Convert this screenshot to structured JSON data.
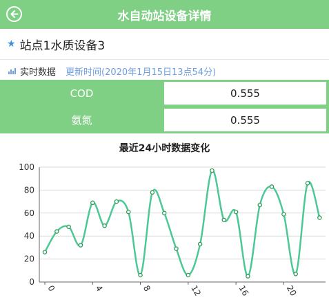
{
  "header": {
    "title": "水自动站设备详情",
    "back_icon": "back-arrow-icon"
  },
  "device": {
    "star_icon": "★",
    "name": "站点1水质设备3"
  },
  "realtime": {
    "label": "实时数据",
    "update_text": "更新时间(2020年1月15日13点54分)"
  },
  "readings": [
    {
      "label": "COD",
      "value": "0.555"
    },
    {
      "label": "氨氮",
      "value": "0.555"
    }
  ],
  "chart_data": {
    "type": "line",
    "title": "最近24小时数据变化",
    "x": [
      0,
      1,
      2,
      3,
      4,
      5,
      6,
      7,
      8,
      9,
      10,
      11,
      12,
      13,
      14,
      15,
      16,
      17,
      18,
      19,
      20,
      21,
      22,
      23
    ],
    "values": [
      26,
      44,
      48,
      32,
      69,
      49,
      70,
      61,
      6,
      78,
      60,
      29,
      6,
      33,
      97,
      54,
      61,
      5,
      67,
      83,
      59,
      7,
      86,
      56
    ],
    "ylim": [
      0,
      100
    ],
    "yticks": [
      0,
      20,
      40,
      60,
      80,
      100
    ],
    "xticks": [
      0,
      4,
      8,
      12,
      16,
      20
    ],
    "line_color": "#4cc796",
    "grid": true
  },
  "colors": {
    "accent": "#7fcf84",
    "link": "#6c9fe0",
    "star": "#3f8fd9"
  }
}
